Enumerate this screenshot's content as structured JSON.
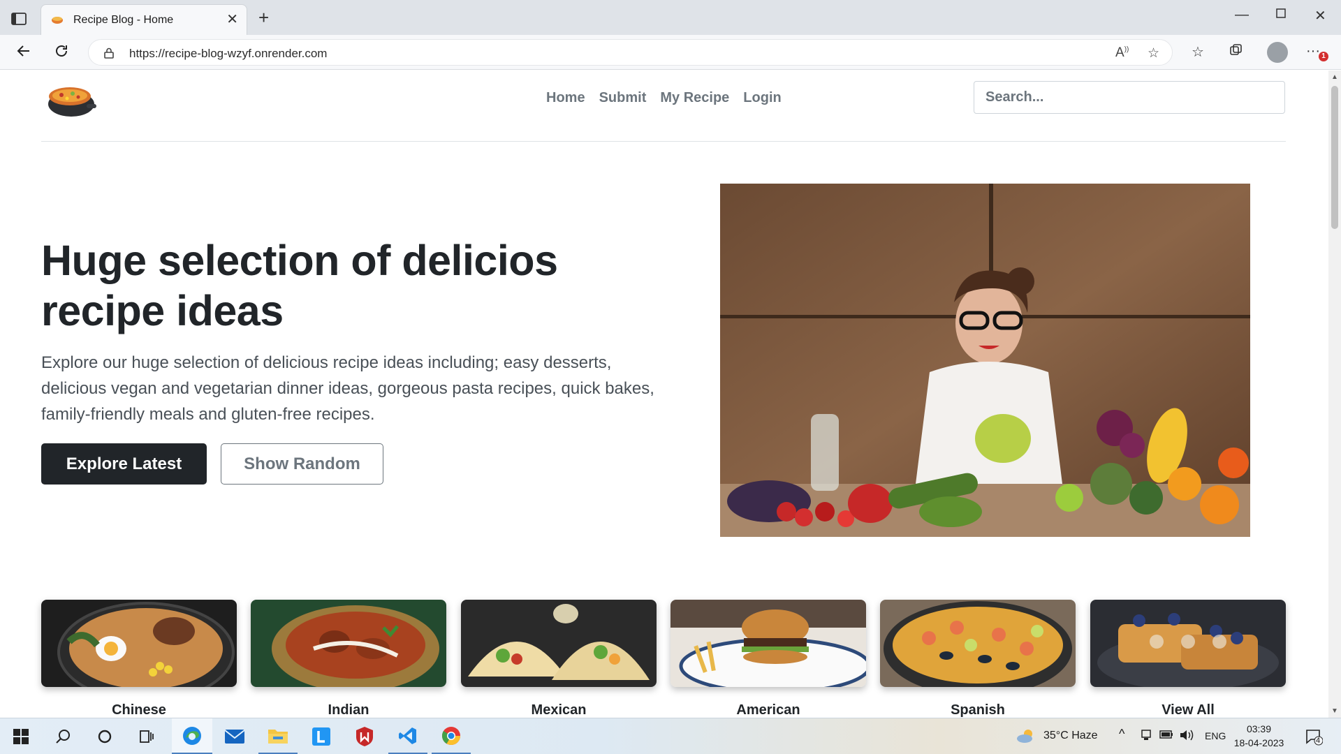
{
  "browser": {
    "tab_title": "Recipe Blog - Home",
    "url": "https://recipe-blog-wzyf.onrender.com",
    "notification_count": "1"
  },
  "site": {
    "nav": [
      {
        "label": "Home"
      },
      {
        "label": "Submit"
      },
      {
        "label": "My Recipe"
      },
      {
        "label": "Login"
      }
    ],
    "search_placeholder": "Search...",
    "hero": {
      "title": "Huge selection of delicios recipe ideas",
      "text": "Explore our huge selection of delicious recipe ideas including; easy desserts, delicious vegan and vegetarian dinner ideas, gorgeous pasta recipes, quick bakes, family-friendly meals and gluten-free recipes.",
      "primary_button": "Explore Latest",
      "secondary_button": "Show Random"
    },
    "categories": [
      {
        "label": "Chinese"
      },
      {
        "label": "Indian"
      },
      {
        "label": "Mexican"
      },
      {
        "label": "American"
      },
      {
        "label": "Spanish"
      },
      {
        "label": "View All"
      }
    ]
  },
  "taskbar": {
    "weather": "35°C  Haze",
    "language": "ENG",
    "time": "03:39",
    "date": "18-04-2023",
    "notification_count": "4"
  },
  "colors": {
    "primary_button": "#212529",
    "nav_text": "#6c757d",
    "tabbar": "#dfe3e8"
  }
}
